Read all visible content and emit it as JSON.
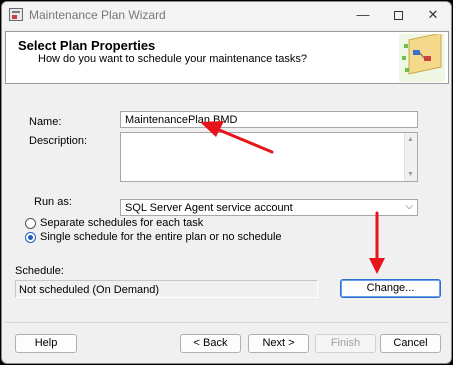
{
  "window": {
    "title": "Maintenance Plan Wizard",
    "controls": {
      "minimize": "—",
      "close": "✕"
    }
  },
  "header": {
    "title": "Select Plan Properties",
    "subtitle": "How do you want to schedule your maintenance tasks?"
  },
  "form": {
    "name_label": "Name:",
    "name_value": "MaintenancePlan BMD",
    "description_label": "Description:",
    "description_value": "",
    "run_as_label": "Run as:",
    "run_as_value": "SQL Server Agent service account",
    "schedule_options": [
      {
        "label": "Separate schedules for each task",
        "checked": false
      },
      {
        "label": "Single schedule for the entire plan or no schedule",
        "checked": true
      }
    ],
    "schedule_label": "Schedule:",
    "schedule_value": "Not scheduled (On Demand)",
    "change_button": "Change..."
  },
  "footer": {
    "help": "Help",
    "back": "< Back",
    "next": "Next >",
    "finish": "Finish",
    "cancel": "Cancel"
  },
  "colors": {
    "annotation_arrow": "#e8141b",
    "accent": "#2b6fd1"
  },
  "icons": [
    "app-icon",
    "wizard-graphic-icon",
    "chevron-down-icon",
    "scroll-up-icon",
    "scroll-down-icon"
  ]
}
